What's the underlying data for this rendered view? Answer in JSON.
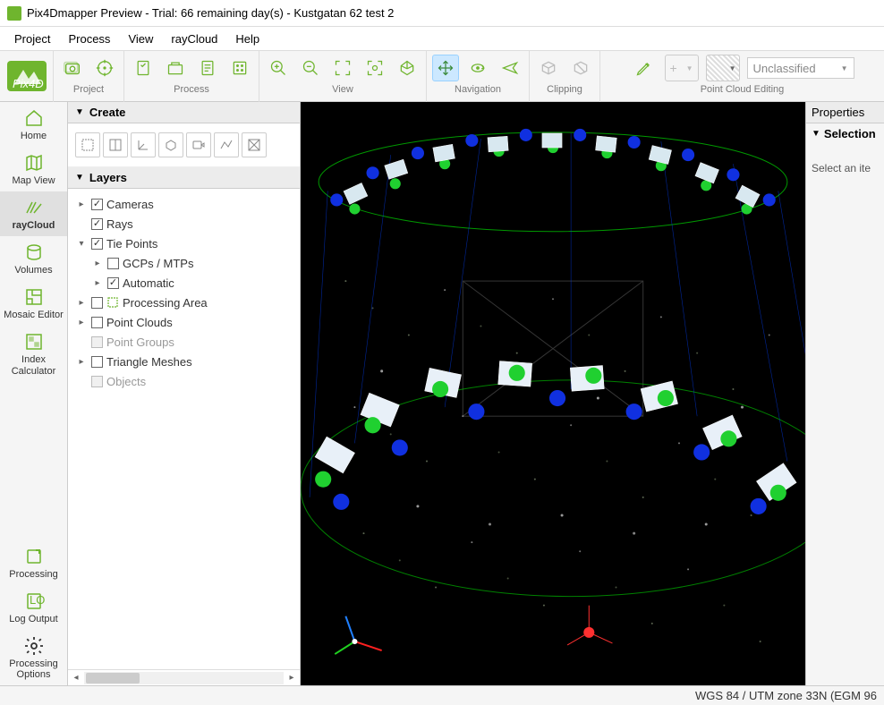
{
  "titlebar": {
    "text": "Pix4Dmapper Preview - Trial: 66 remaining day(s) - Kustgatan 62 test 2"
  },
  "menus": [
    "Project",
    "Process",
    "View",
    "rayCloud",
    "Help"
  ],
  "toolbar": {
    "groups": {
      "project": "Project",
      "process": "Process",
      "view": "View",
      "navigation": "Navigation",
      "clipping": "Clipping",
      "pce": "Point Cloud Editing"
    },
    "pce_dropdown": "Unclassified"
  },
  "sidebar": {
    "items": [
      {
        "label": "Home"
      },
      {
        "label": "Map View"
      },
      {
        "label": "rayCloud"
      },
      {
        "label": "Volumes"
      },
      {
        "label": "Mosaic Editor"
      },
      {
        "label": "Index Calculator"
      }
    ],
    "bottom": [
      {
        "label": "Processing"
      },
      {
        "label": "Log Output"
      },
      {
        "label": "Processing Options"
      }
    ]
  },
  "panels": {
    "create": "Create",
    "layers": "Layers"
  },
  "layers": {
    "cameras": "Cameras",
    "rays": "Rays",
    "tiepoints": "Tie Points",
    "gcps": "GCPs / MTPs",
    "automatic": "Automatic",
    "processing_area": "Processing Area",
    "point_clouds": "Point Clouds",
    "point_groups": "Point Groups",
    "triangle_meshes": "Triangle Meshes",
    "objects": "Objects"
  },
  "right": {
    "properties": "Properties",
    "selection": "Selection",
    "empty": "Select an ite"
  },
  "status": {
    "text": "WGS 84 / UTM zone 33N (EGM 96"
  }
}
